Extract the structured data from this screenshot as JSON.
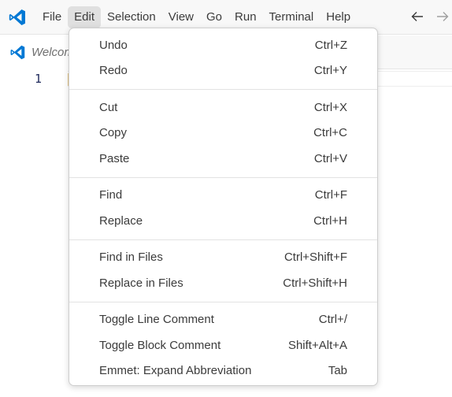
{
  "menubar": {
    "items": [
      "File",
      "Edit",
      "Selection",
      "View",
      "Go",
      "Run",
      "Terminal",
      "Help"
    ],
    "active": "Edit"
  },
  "tab": {
    "label": "Welcome"
  },
  "editor": {
    "line_number": "1"
  },
  "edit_menu": {
    "groups": [
      [
        {
          "label": "Undo",
          "shortcut": "Ctrl+Z"
        },
        {
          "label": "Redo",
          "shortcut": "Ctrl+Y"
        }
      ],
      [
        {
          "label": "Cut",
          "shortcut": "Ctrl+X"
        },
        {
          "label": "Copy",
          "shortcut": "Ctrl+C"
        },
        {
          "label": "Paste",
          "shortcut": "Ctrl+V"
        }
      ],
      [
        {
          "label": "Find",
          "shortcut": "Ctrl+F"
        },
        {
          "label": "Replace",
          "shortcut": "Ctrl+H"
        }
      ],
      [
        {
          "label": "Find in Files",
          "shortcut": "Ctrl+Shift+F"
        },
        {
          "label": "Replace in Files",
          "shortcut": "Ctrl+Shift+H"
        }
      ],
      [
        {
          "label": "Toggle Line Comment",
          "shortcut": "Ctrl+/"
        },
        {
          "label": "Toggle Block Comment",
          "shortcut": "Shift+Alt+A"
        },
        {
          "label": "Emmet: Expand Abbreviation",
          "shortcut": "Tab"
        }
      ]
    ]
  },
  "colors": {
    "brand": "#0078d4",
    "menu_active_bg": "#e0e0e0"
  }
}
